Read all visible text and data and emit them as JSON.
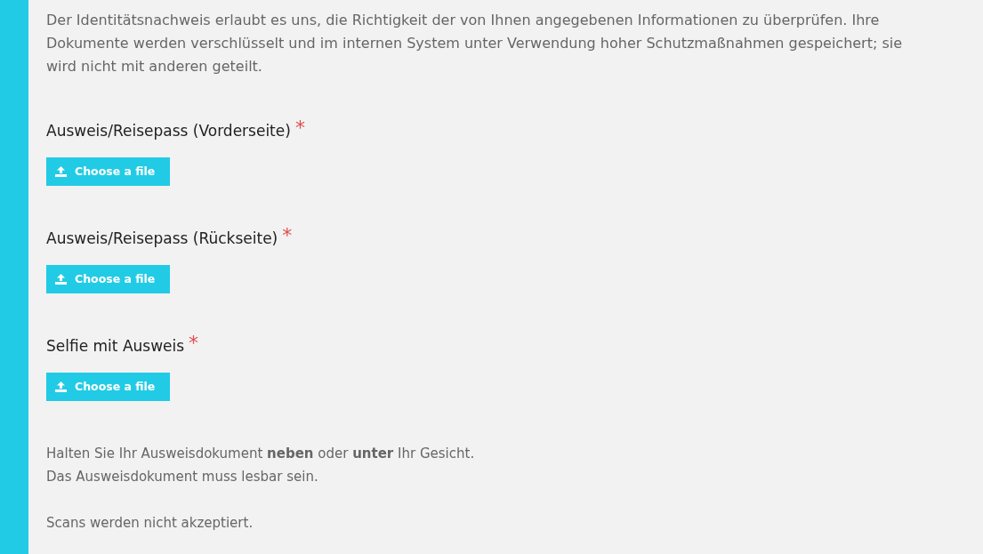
{
  "intro": "Der Identitätsnachweis erlaubt es uns, die Richtigkeit der von Ihnen angegebenen Informationen zu überprüfen. Ihre Dokumente werden verschlüsselt und im internen System unter Verwendung hoher Schutzmaßnahmen gespeichert; sie wird nicht mit anderen geteilt.",
  "fields": [
    {
      "label": "Ausweis/Reisepass (Vorderseite)",
      "required": true,
      "required_mark": "*",
      "button": "Choose a file"
    },
    {
      "label": "Ausweis/Reisepass (Rückseite)",
      "required": true,
      "required_mark": "*",
      "button": "Choose a file"
    },
    {
      "label": "Selfie mit Ausweis",
      "required": true,
      "required_mark": "*",
      "button": "Choose a file"
    }
  ],
  "note_paragraphs": [
    {
      "lines": [
        "Halten Sie Ihr Ausweisdokument **neben** oder **unter** Ihr Gesicht.",
        "Das Ausweisdokument muss lesbar sein."
      ]
    },
    {
      "lines": [
        "Scans werden nicht akzeptiert."
      ]
    }
  ]
}
